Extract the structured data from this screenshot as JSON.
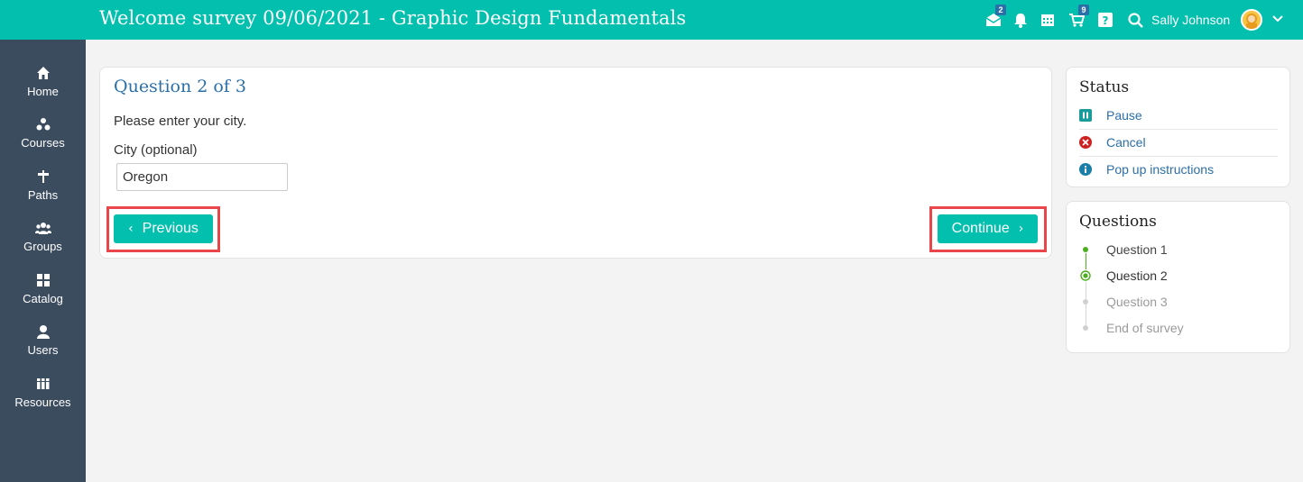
{
  "header": {
    "title": "Welcome survey 09/06/2021 - Graphic Design Fundamentals",
    "inbox_badge": "2",
    "cart_badge": "9",
    "user_name": "Sally Johnson",
    "icons": [
      "inbox-icon",
      "bell-icon",
      "calendar-icon",
      "cart-icon",
      "help-icon",
      "search-icon",
      "avatar",
      "chevron-down-icon"
    ]
  },
  "sidebar": {
    "items": [
      {
        "label": "Home",
        "icon": "home-icon"
      },
      {
        "label": "Courses",
        "icon": "courses-icon"
      },
      {
        "label": "Paths",
        "icon": "paths-icon"
      },
      {
        "label": "Groups",
        "icon": "groups-icon"
      },
      {
        "label": "Catalog",
        "icon": "catalog-icon"
      },
      {
        "label": "Users",
        "icon": "users-icon"
      },
      {
        "label": "Resources",
        "icon": "resources-icon"
      }
    ]
  },
  "question": {
    "title": "Question 2 of 3",
    "text": "Please enter your city.",
    "field_label": "City (optional)",
    "field_value": "Oregon",
    "previous_label": "Previous",
    "continue_label": "Continue"
  },
  "status_panel": {
    "title": "Status",
    "items": [
      {
        "label": "Pause",
        "icon": "pause-icon"
      },
      {
        "label": "Cancel",
        "icon": "cancel-icon"
      },
      {
        "label": "Pop up instructions",
        "icon": "info-icon"
      }
    ]
  },
  "questions_panel": {
    "title": "Questions",
    "items": [
      {
        "label": "Question 1",
        "state": "done"
      },
      {
        "label": "Question 2",
        "state": "current"
      },
      {
        "label": "Question 3",
        "state": "pending"
      },
      {
        "label": "End of survey",
        "state": "pending"
      }
    ]
  },
  "colors": {
    "accent": "#03bfae",
    "sidebar": "#3c4c5f",
    "link": "#2c6fa8",
    "highlight": "#e8464b",
    "done": "#4caf20",
    "pending": "#cfcfcf"
  }
}
